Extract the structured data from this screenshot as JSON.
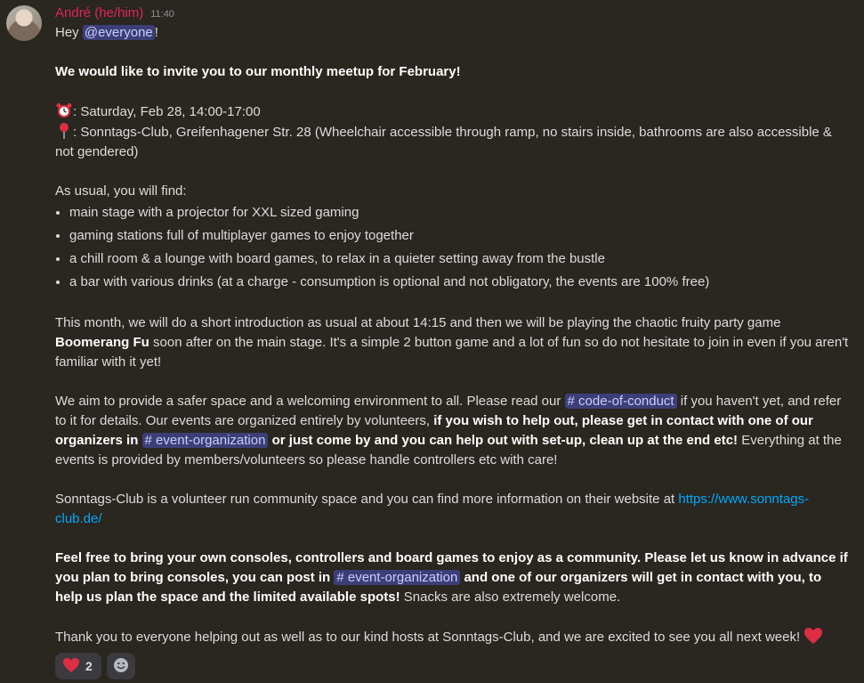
{
  "author": "André (he/him)",
  "time": "11:40",
  "greeting_prefix": "Hey ",
  "mention": "@everyone",
  "greeting_suffix": "!",
  "headline": "We would like to invite you to our monthly meetup for February!",
  "when_text": ": Saturday, Feb 28, 14:00-17:00",
  "where_text": ": Sonntags-Club, Greifenhagener Str. 28 (Wheelchair accessible through ramp, no stairs inside, bathrooms are also accessible & not gendered)",
  "as_usual": "As usual, you will find:",
  "bullets": [
    "main stage with a projector for XXL sized gaming",
    "gaming stations full of multiplayer games to enjoy together",
    "a chill room & a lounge with board games, to relax in a quieter setting away from the bustle",
    "a bar with various drinks (at a charge - consumption is optional and not obligatory, the events are 100% free)"
  ],
  "p2_a": "This month, we will do a short introduction as usual at about 14:15 and then we will be playing the chaotic fruity party game ",
  "p2_game": "Boomerang Fu",
  "p2_b": " soon after on the main stage. It's a simple 2 button game and a lot of fun so do not hesitate to join in even if you aren't familiar with it yet!",
  "p3_a": "We aim to provide a safer space and a welcoming environment to all. Please read our ",
  "channel_coc": "# code-of-conduct",
  "p3_b": " if you haven't yet, and refer to it for details. Our events are organized entirely by volunteers, ",
  "p3_bold1": "if you wish to help out, please get in contact with one of our organizers in ",
  "channel_eo": "# event-organization",
  "p3_bold2": " or just come by and you can help out with set-up, clean up at the end etc!",
  "p3_c": " Everything at the events is provided by members/volunteers so please handle controllers etc with care!",
  "p4_a": "Sonntags-Club is a volunteer run community space and you can find more information on their website at ",
  "p4_link": "https://www.sonntags-club.de/",
  "p5_bold1": "Feel free to bring your own consoles, controllers and board games to enjoy as a community. Please let us know in advance if you plan to bring consoles, you can post in ",
  "p5_bold2": " and one of our organizers will get in contact with you, to help us plan the space and the limited available spots!",
  "p5_c": " Snacks are also extremely welcome.",
  "p6": "Thank you to everyone helping out as well as to our kind hosts at Sonntags-Club, and we are excited to see you all next week! ",
  "reaction_count": "2",
  "icons": {
    "clock": "alarm-clock-icon",
    "pin": "round-pushpin-icon",
    "heart": "heart-icon",
    "add": "smiley-icon"
  },
  "colors": {
    "author": "#e0245e",
    "mention_bg": "#3c3f77",
    "link": "#00a8fc",
    "heart": "#e05263"
  }
}
